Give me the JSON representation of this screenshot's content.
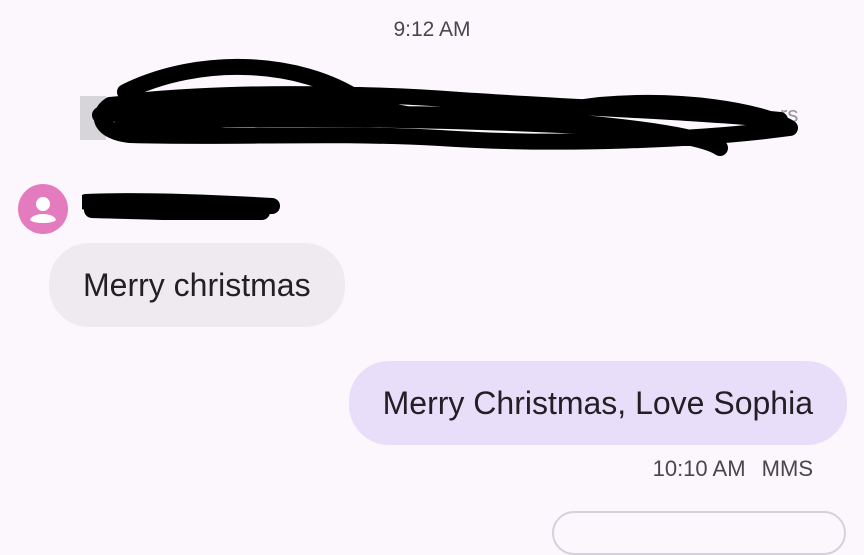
{
  "conversation": {
    "top_timestamp": "9:12 AM",
    "info_banner": {
      "trailing_text": "rs",
      "redacted": true
    },
    "incoming": {
      "sender_redacted": true,
      "message": "Merry christmas"
    },
    "outgoing": {
      "message": "Merry Christmas, Love Sophia",
      "time": "10:10 AM",
      "type": "MMS"
    }
  },
  "colors": {
    "background": "#fbf7fd",
    "incoming_bubble": "#efeaf0",
    "outgoing_bubble": "#e8defa",
    "avatar": "#e57bbf",
    "redaction": "#000000"
  },
  "icons": {
    "avatar": "person-icon",
    "banner": "group-icon"
  }
}
